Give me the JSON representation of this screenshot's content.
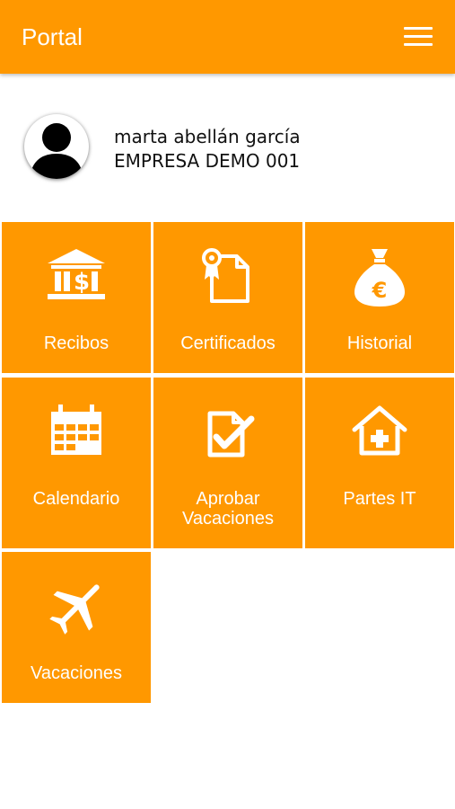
{
  "header": {
    "title": "Portal",
    "menu_icon": "hamburger-menu-icon"
  },
  "profile": {
    "name": "marta abellán garcía",
    "company": "EMPRESA DEMO 001",
    "avatar_icon": "user-silhouette-icon"
  },
  "tiles": [
    {
      "label": "Recibos",
      "icon": "bank-payment-icon"
    },
    {
      "label": "Certificados",
      "icon": "certificate-document-icon"
    },
    {
      "label": "Historial",
      "icon": "euro-money-bag-icon"
    },
    {
      "label": "Calendario",
      "icon": "calendar-icon"
    },
    {
      "label_line1": "Aprobar",
      "label_line2": "Vacaciones",
      "icon": "approve-document-check-icon"
    },
    {
      "label": "Partes IT",
      "icon": "medical-house-icon"
    },
    {
      "label": "Vacaciones",
      "icon": "airplane-icon"
    }
  ],
  "colors": {
    "accent": "#ff9800",
    "text_on_accent": "#ffffff",
    "text": "#111111"
  }
}
